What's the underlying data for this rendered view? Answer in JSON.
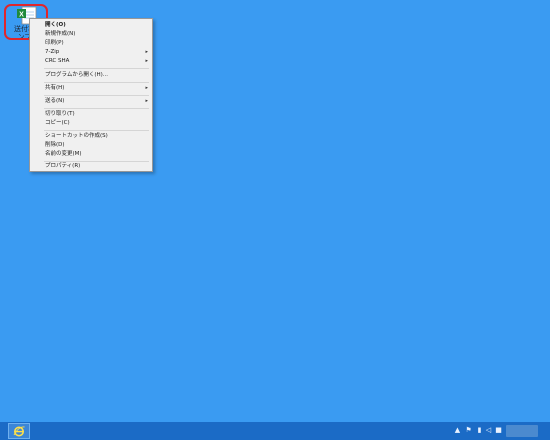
{
  "desktop": {
    "background_color": "#3a9bf2",
    "icon": {
      "name": "spreadsheet-file-icon",
      "caption_line1": "送付状テ",
      "caption_line2": "ンプレ"
    }
  },
  "context_menu": {
    "items": [
      {
        "label": "開く(O)",
        "bold": true,
        "submenu": false
      },
      {
        "label": "新規作成(N)",
        "bold": false,
        "submenu": false
      },
      {
        "label": "印刷(P)",
        "bold": false,
        "submenu": false
      },
      {
        "label": "7-Zip",
        "bold": false,
        "submenu": true
      },
      {
        "label": "CRC SHA",
        "bold": false,
        "submenu": true
      },
      {
        "label": "プログラムから開く(H)...",
        "bold": false,
        "submenu": false
      },
      {
        "label": "共有(H)",
        "bold": false,
        "submenu": true
      },
      {
        "label": "送る(N)",
        "bold": false,
        "submenu": true
      },
      {
        "label": "切り取り(T)",
        "bold": false,
        "submenu": false
      },
      {
        "label": "コピー(C)",
        "bold": false,
        "submenu": false
      },
      {
        "label": "ショートカットの作成(S)",
        "bold": false,
        "submenu": false
      },
      {
        "label": "削除(D)",
        "bold": false,
        "submenu": false
      },
      {
        "label": "名前の変更(M)",
        "bold": false,
        "submenu": false
      },
      {
        "label": "プロパティ(R)",
        "bold": false,
        "submenu": false
      }
    ],
    "submenu_arrow": "▸"
  },
  "taskbar": {
    "pinned": [
      {
        "name": "internet-explorer-icon"
      }
    ],
    "tray": {
      "up_arrow": "▲",
      "icons": [
        "flag-icon",
        "network-icon",
        "volume-icon",
        "ime-icon"
      ]
    },
    "accent_color": "#1b6bc6"
  }
}
